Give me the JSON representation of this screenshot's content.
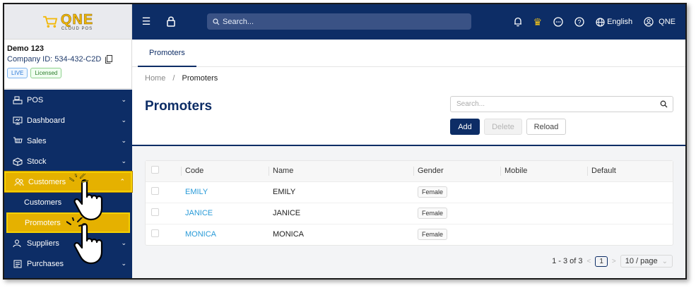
{
  "logo": {
    "brand": "QNE",
    "sub": "CLOUD POS"
  },
  "company": {
    "name": "Demo 123",
    "id_label": "Company ID: 534-432-C2D",
    "badge_live": "LIVE",
    "badge_licensed": "Licensed"
  },
  "sidebar": {
    "items": [
      {
        "label": "POS",
        "icon": "pos-icon"
      },
      {
        "label": "Dashboard",
        "icon": "dashboard-icon"
      },
      {
        "label": "Sales",
        "icon": "sales-icon"
      },
      {
        "label": "Stock",
        "icon": "stock-icon"
      },
      {
        "label": "Customers",
        "icon": "customers-icon"
      }
    ],
    "subitems": [
      {
        "label": "Customers"
      },
      {
        "label": "Promoters"
      }
    ],
    "items_after": [
      {
        "label": "Suppliers",
        "icon": "suppliers-icon"
      },
      {
        "label": "Purchases",
        "icon": "purchases-icon"
      }
    ]
  },
  "topbar": {
    "search_placeholder": "Search...",
    "language": "English",
    "user": "QNE"
  },
  "tabs": [
    {
      "label": "Promoters"
    }
  ],
  "breadcrumb": {
    "home": "Home",
    "sep": "/",
    "current": "Promoters"
  },
  "page": {
    "title": "Promoters",
    "search_placeholder": "Search...",
    "add_label": "Add",
    "delete_label": "Delete",
    "reload_label": "Reload"
  },
  "table": {
    "headers": [
      "Code",
      "Name",
      "Gender",
      "Mobile",
      "Default"
    ],
    "rows": [
      {
        "code": "EMILY",
        "name": "EMILY",
        "gender": "Female",
        "mobile": "",
        "default": ""
      },
      {
        "code": "JANICE",
        "name": "JANICE",
        "gender": "Female",
        "mobile": "",
        "default": ""
      },
      {
        "code": "MONICA",
        "name": "MONICA",
        "gender": "Female",
        "mobile": "",
        "default": ""
      }
    ]
  },
  "pager": {
    "range": "1 - 3 of 3",
    "page": "1",
    "page_size": "10 / page"
  },
  "colors": {
    "navy": "#0d2d66",
    "highlight": "#e5b100",
    "link": "#2a9bd8"
  }
}
